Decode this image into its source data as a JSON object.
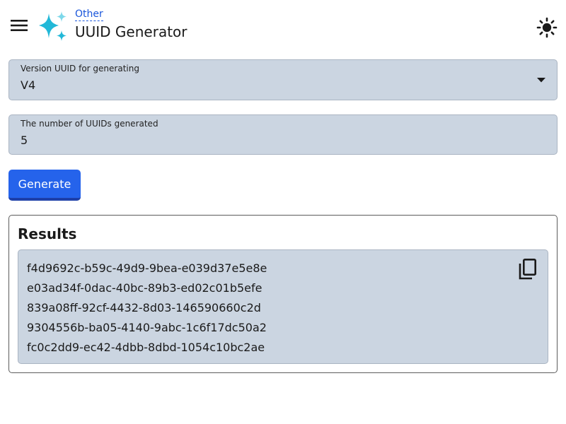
{
  "header": {
    "menu_icon": "hamburger-menu-icon",
    "logo_icon": "sparkles-icon",
    "breadcrumb": "Other",
    "title": "UUID Generator",
    "theme_icon": "sun-icon"
  },
  "form": {
    "version_field": {
      "label": "Version UUID for generating",
      "value": "V4",
      "icon": "caret-down-icon"
    },
    "count_field": {
      "label": "The number of UUIDs generated",
      "value": "5"
    },
    "generate_label": "Generate"
  },
  "results": {
    "title": "Results",
    "copy_icon": "copy-icon",
    "uuids": [
      "f4d9692c-b59c-49d9-9bea-e039d37e5e8e",
      "e03ad34f-0dac-40bc-89b3-ed02c01b5efe",
      "839a08ff-92cf-4432-8d03-146590660c2d",
      "9304556b-ba05-4140-9abc-1c6f17dc50a2",
      "fc0c2dd9-ec42-4dbb-8dbd-1054c10bc2ae"
    ]
  },
  "colors": {
    "accent": "#2563eb",
    "link": "#1a56db",
    "field_bg": "#cbd5e1",
    "logo_primary": "#22b8d8",
    "logo_secondary": "#7dd8ea"
  }
}
